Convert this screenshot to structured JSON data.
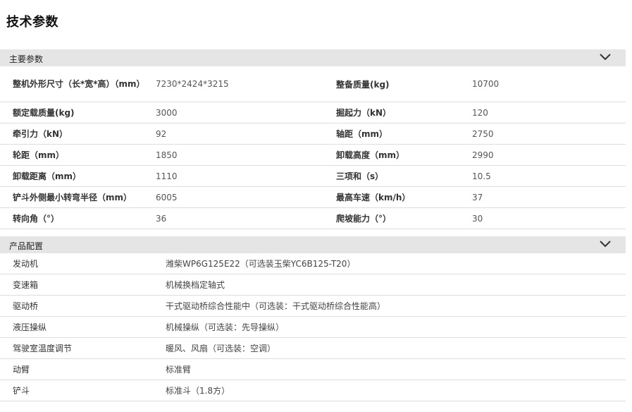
{
  "page_title": "技术参数",
  "sections": {
    "main_params": {
      "title": "主要参数",
      "rows": [
        {
          "k1": "整机外形尺寸（长*宽*高）（mm）",
          "v1": "7230*2424*3215",
          "k2": "整备质量(kg)",
          "v2": "10700"
        },
        {
          "k1": "额定载质量(kg)",
          "v1": "3000",
          "k2": "掘起力（kN）",
          "v2": "120"
        },
        {
          "k1": "牵引力（kN）",
          "v1": "92",
          "k2": "轴距（mm）",
          "v2": "2750"
        },
        {
          "k1": "轮距（mm）",
          "v1": "1850",
          "k2": "卸载高度（mm）",
          "v2": "2990"
        },
        {
          "k1": "卸载距离（mm）",
          "v1": "1110",
          "k2": "三项和（s）",
          "v2": "10.5"
        },
        {
          "k1": "铲斗外侧最小转弯半径（mm）",
          "v1": "6005",
          "k2": "最高车速（km/h）",
          "v2": "37"
        },
        {
          "k1": "转向角（°）",
          "v1": "36",
          "k2": "爬坡能力（°）",
          "v2": "30"
        }
      ]
    },
    "config": {
      "title": "产品配置",
      "rows": [
        {
          "k": "发动机",
          "v": "潍柴WP6G125E22（可选装玉柴YC6B125-T20）"
        },
        {
          "k": "变速箱",
          "v": "机械换档定轴式"
        },
        {
          "k": "驱动桥",
          "v": "干式驱动桥综合性能中（可选装：干式驱动桥综合性能高）"
        },
        {
          "k": "液压操纵",
          "v": "机械操纵（可选装：先导操纵）"
        },
        {
          "k": "驾驶室温度调节",
          "v": "暖风、风扇（可选装：空调）"
        },
        {
          "k": "动臂",
          "v": "标准臂"
        },
        {
          "k": "铲斗",
          "v": "标准斗（1.8方）"
        }
      ]
    }
  },
  "icons": {
    "collapse": "chevron-down-icon"
  },
  "colors": {
    "header_bg": "#e5e5e5",
    "divider": "#dddddd"
  }
}
